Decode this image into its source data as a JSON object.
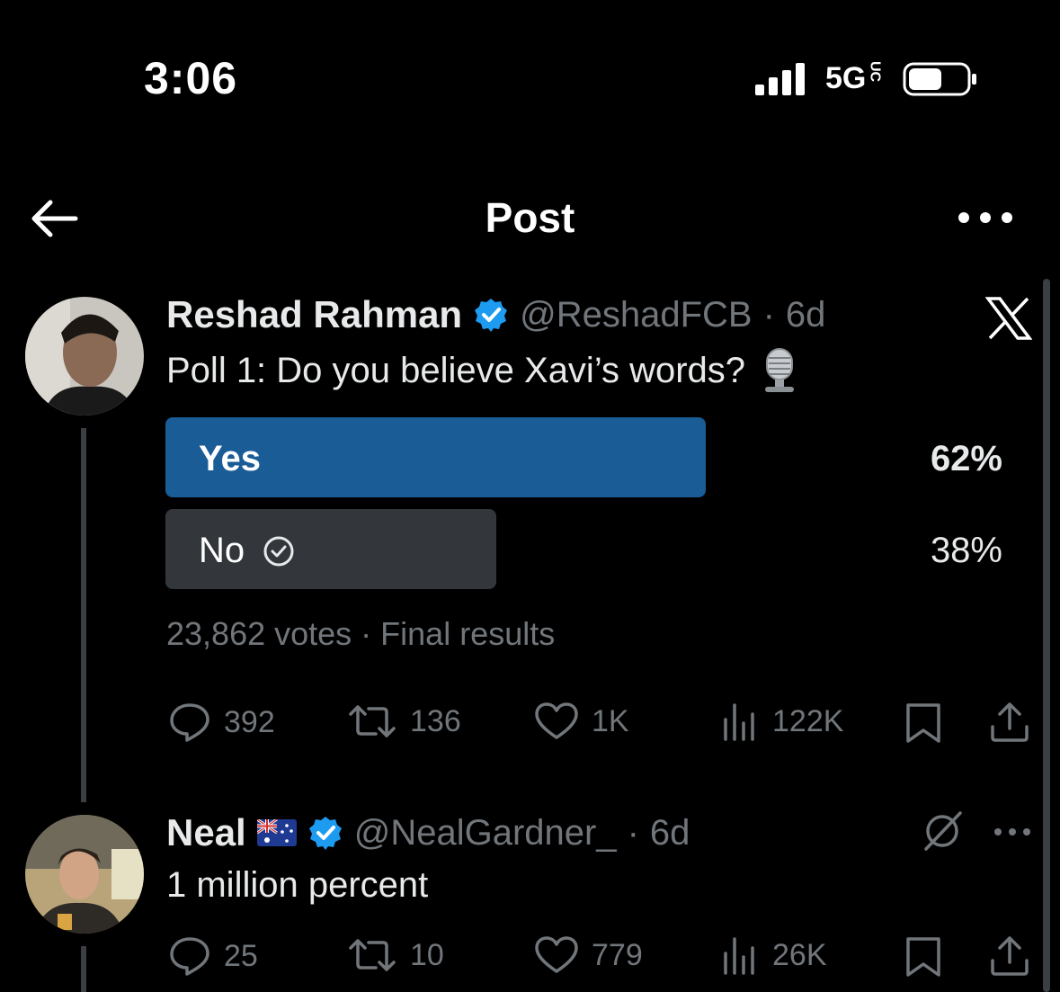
{
  "status_bar": {
    "time": "3:06",
    "network": "5G",
    "network_suffix": "UC"
  },
  "header": {
    "title": "Post"
  },
  "post": {
    "author_name": "Reshad Rahman",
    "handle": "@ReshadFCB",
    "time": "6d",
    "text": "Poll 1: Do you believe Xavi’s words?",
    "poll": {
      "options": [
        {
          "label": "Yes",
          "percent_label": "62%",
          "percent": 62,
          "winner": true
        },
        {
          "label": "No",
          "percent_label": "38%",
          "percent": 38,
          "selected": true
        }
      ],
      "votes": "23,862 votes",
      "status": "Final results"
    },
    "stats": {
      "replies": "392",
      "reposts": "136",
      "likes": "1K",
      "views": "122K"
    }
  },
  "reply": {
    "author_name": "Neal",
    "handle": "@NealGardner_",
    "time": "6d",
    "text": "1 million percent",
    "stats": {
      "replies": "25",
      "reposts": "10",
      "likes": "779",
      "views": "26K"
    }
  },
  "colors": {
    "accent": "#1d9bf0",
    "poll_winner": "#1a5c96",
    "poll_other": "#33363a"
  }
}
